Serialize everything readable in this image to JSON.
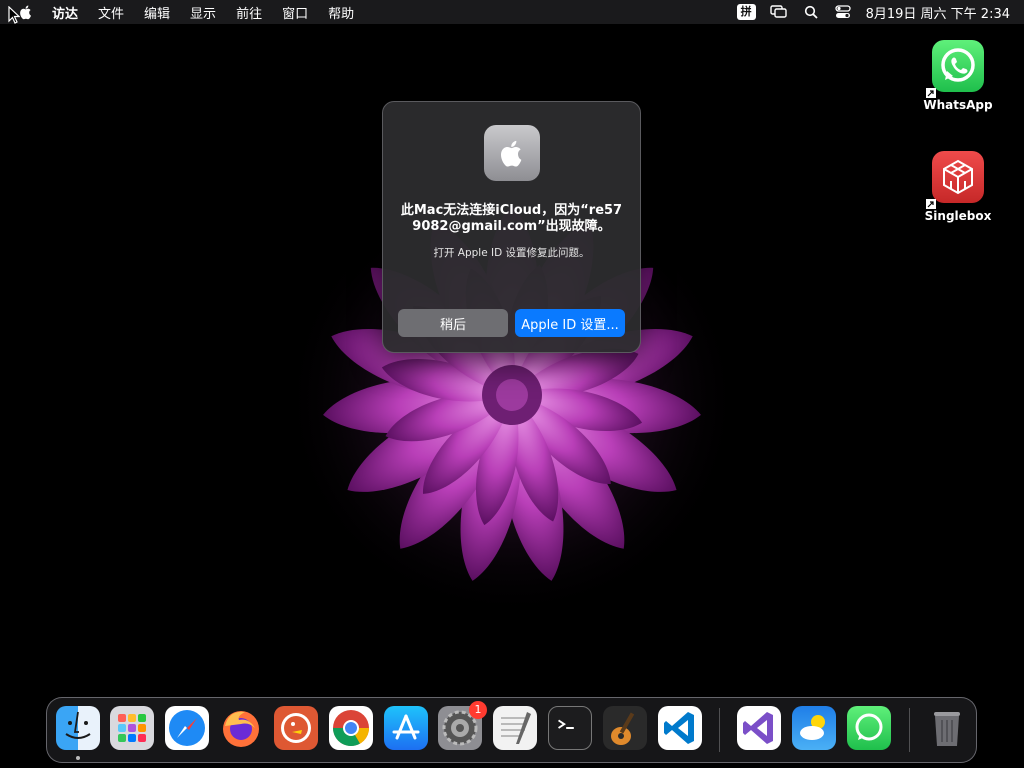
{
  "menubar": {
    "items": [
      "访达",
      "文件",
      "编辑",
      "显示",
      "前往",
      "窗口",
      "帮助"
    ],
    "ime": "拼",
    "clock": "8月19日 周六  下午 2:34"
  },
  "desktop": {
    "icons": [
      {
        "label": "WhatsApp",
        "icon": "whatsapp-icon",
        "color": "#25d366"
      },
      {
        "label": "Singlebox",
        "icon": "singlebox-icon",
        "color": "#e53935"
      }
    ]
  },
  "dialog": {
    "title": "此Mac无法连接iCloud，因为“re579082@gmail.com”出现故障。",
    "message": "打开 Apple ID 设置修复此问题。",
    "later_button": "稍后",
    "settings_button": "Apple ID 设置..."
  },
  "dock": {
    "apps": [
      "finder-icon",
      "launchpad-icon",
      "safari-icon",
      "firefox-icon",
      "duckduckgo-icon",
      "chrome-icon",
      "app-store-icon",
      "system-settings-icon",
      "textedit-icon",
      "terminal-icon",
      "garageband-icon",
      "vscode-icon",
      "visual-studio-icon",
      "weather-icon",
      "whatsapp-icon",
      "trash-icon"
    ],
    "system_settings_badge": "1"
  },
  "colors": {
    "accent": "#0a7aff",
    "flower": "#b23fb5"
  }
}
